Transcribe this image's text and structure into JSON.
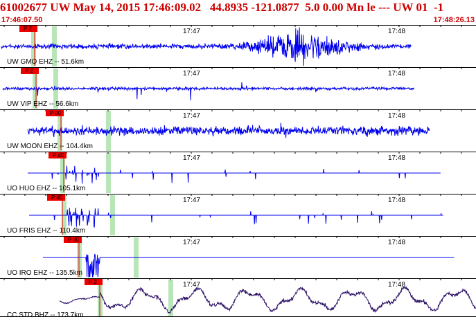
{
  "header": {
    "title": "61002677 UW May 14, 2015 17:46:09.02   44.8935 -121.0877  5.0 0.00 Mn le --- UW 01  -1",
    "start_time": "17:46:07.50",
    "end_time": "17:48:26.13"
  },
  "colors": {
    "header_text": "#cc0000",
    "trace": "#0000ee",
    "trace_broadband": "#2b0f66",
    "pick_bg": "#ee0000",
    "pick_window": "#b8e6b8",
    "divider": "#000000"
  },
  "time_axis": {
    "minute_labels": [
      "17:47",
      "17:48"
    ]
  },
  "panels": [
    {
      "label": "UW GMO EHZ -- 51.6km",
      "pick": "P 2",
      "style": "event"
    },
    {
      "label": "UW VIP EHZ -- 56.6km",
      "pick": "P 2",
      "style": "spiky"
    },
    {
      "label": "UW MOON EHZ -- 104.4km",
      "pick": "P d0",
      "style": "noisy"
    },
    {
      "label": "UO HUO EHZ -- 105.1km",
      "pick": "P d0",
      "style": "flat"
    },
    {
      "label": "UO FRIS EHZ -- 110.4km",
      "pick": "P d0",
      "style": "flat"
    },
    {
      "label": "UO IRO EHZ -- 135.5km",
      "pick": "P d0",
      "style": "clip"
    },
    {
      "label": "CC STD BHZ -- 173.7km",
      "pick": "P 2",
      "style": "wave"
    }
  ]
}
